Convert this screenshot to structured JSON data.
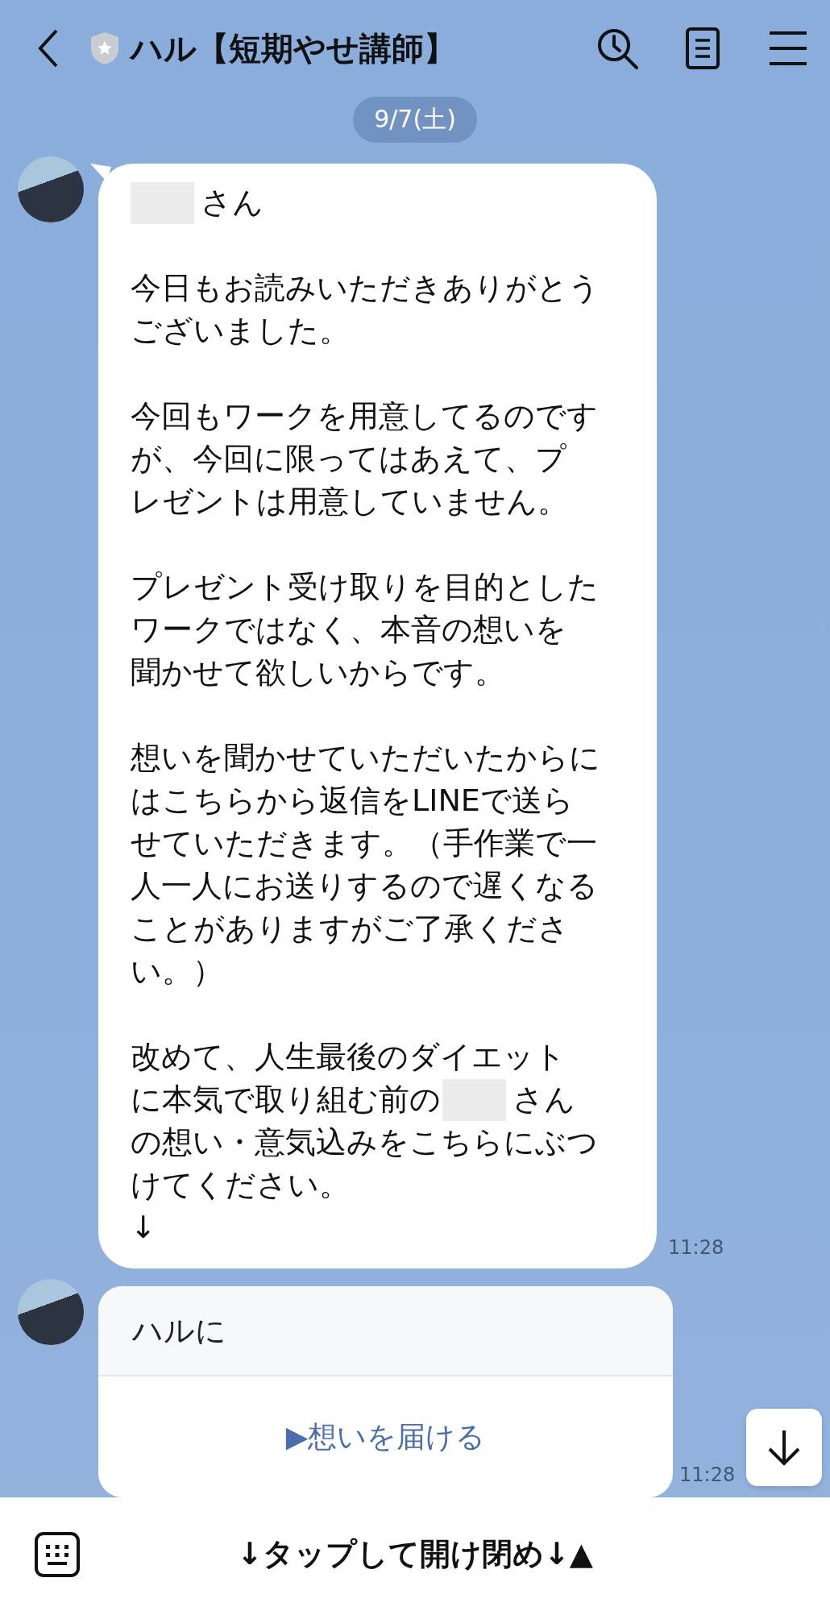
{
  "header": {
    "title": "ハル【短期やせ講師】"
  },
  "date_label": "9/7(土)",
  "messages": [
    {
      "kind": "text",
      "time": "11:28",
      "paragraphs": [
        [
          [
            {
              "kind": "redacted"
            },
            {
              "kind": "text",
              "text": "さん"
            }
          ]
        ],
        [
          [
            {
              "kind": "text",
              "text": "今日もお読みいただきありがとう"
            }
          ],
          [
            {
              "kind": "text",
              "text": "ございました。"
            }
          ]
        ],
        [
          [
            {
              "kind": "text",
              "text": "今回もワークを用意してるのです"
            }
          ],
          [
            {
              "kind": "text",
              "text": "が、今回に限ってはあえて、プ"
            }
          ],
          [
            {
              "kind": "text",
              "text": "レゼントは用意していません。"
            }
          ]
        ],
        [
          [
            {
              "kind": "text",
              "text": "プレゼント受け取りを目的とした"
            }
          ],
          [
            {
              "kind": "text",
              "text": "ワークではなく、本音の想いを"
            }
          ],
          [
            {
              "kind": "text",
              "text": "聞かせて欲しいからです。"
            }
          ]
        ],
        [
          [
            {
              "kind": "text",
              "text": "想いを聞かせていただいたからに"
            }
          ],
          [
            {
              "kind": "text",
              "text": "はこちらから返信をLINEで送ら"
            }
          ],
          [
            {
              "kind": "text",
              "text": "せていただきます。（手作業で一"
            }
          ],
          [
            {
              "kind": "text",
              "text": "人一人にお送りするので遅くなる"
            }
          ],
          [
            {
              "kind": "text",
              "text": "ことがありますがご了承くださ"
            }
          ],
          [
            {
              "kind": "text",
              "text": "い。）"
            }
          ]
        ],
        [
          [
            {
              "kind": "text",
              "text": "改めて、人生最後のダイエット"
            }
          ],
          [
            {
              "kind": "text",
              "text": "に本気で取り組む前の"
            },
            {
              "kind": "redacted"
            },
            {
              "kind": "text",
              "text": "さん"
            }
          ],
          [
            {
              "kind": "text",
              "text": "の想い・意気込みをこちらにぶつ"
            }
          ],
          [
            {
              "kind": "text",
              "text": "けてください。"
            }
          ],
          [
            {
              "kind": "text",
              "text": "↓"
            }
          ]
        ]
      ]
    },
    {
      "kind": "card",
      "time": "11:28",
      "title": "ハルに",
      "action": "▶想いを届ける"
    }
  ],
  "bottom_bar": {
    "label": "↓タップして開け閉め↓▲"
  }
}
